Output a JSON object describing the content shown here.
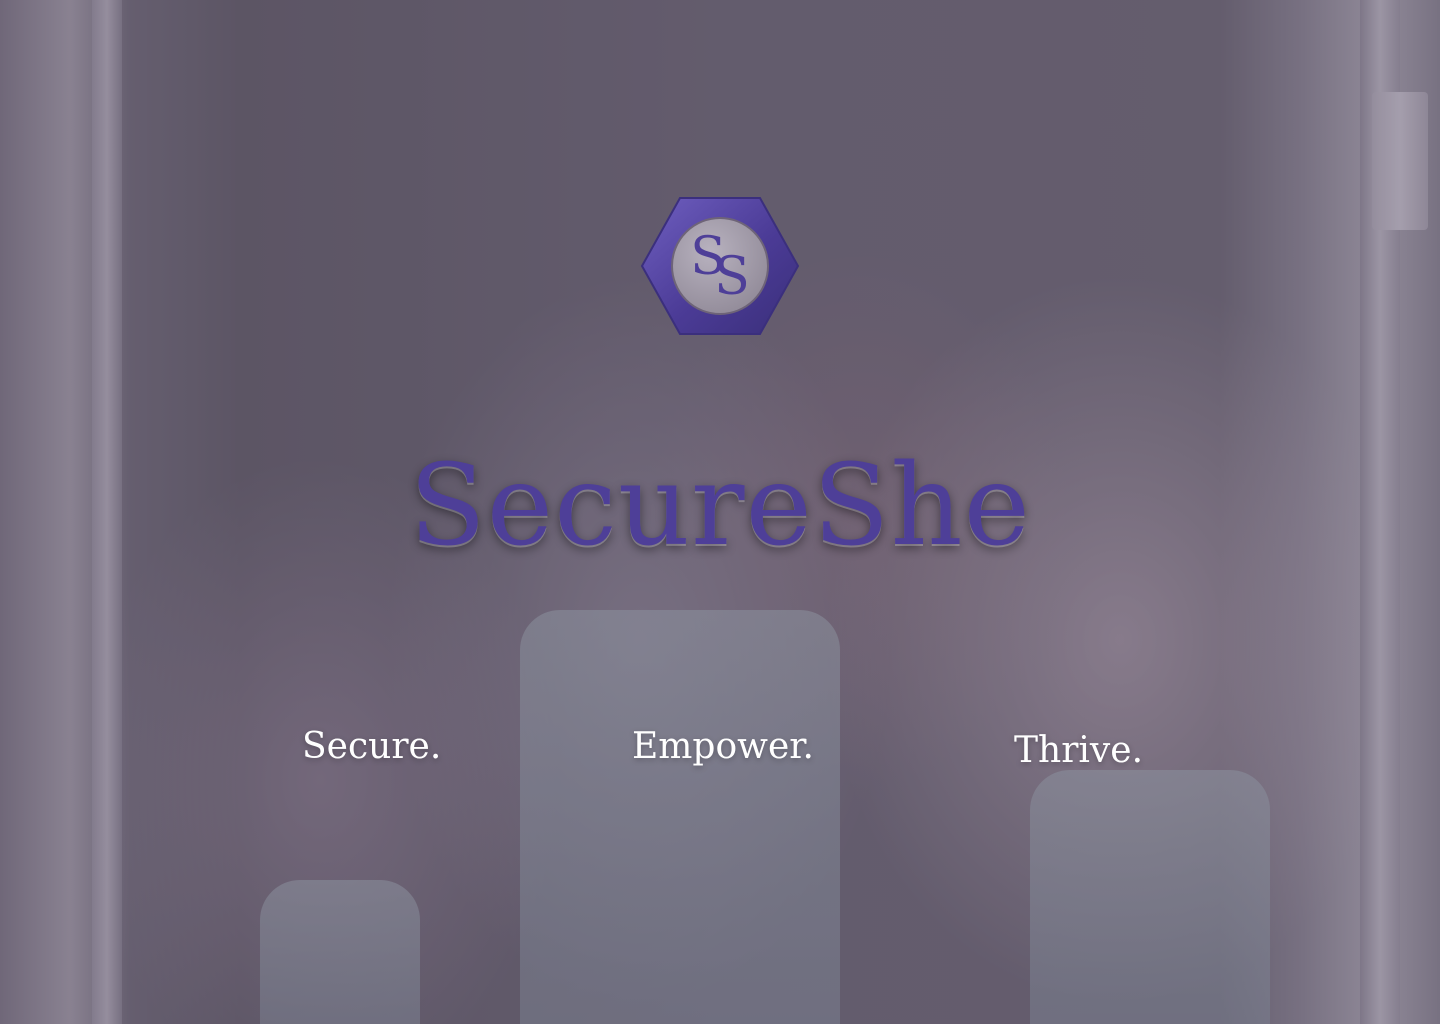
{
  "brand": {
    "name": "SecureShe",
    "logo_monogram": "SS",
    "logo_icon": "hexagon-monogram-icon",
    "colors": {
      "brand_purple": "#4e3f98",
      "logo_hex": "#5b4aa6",
      "tagline": "#ffffff"
    }
  },
  "taglines": {
    "secure": "Secure.",
    "empower": "Empower.",
    "thrive": "Thrive."
  },
  "background": {
    "image_icon": "group-photo-background"
  }
}
